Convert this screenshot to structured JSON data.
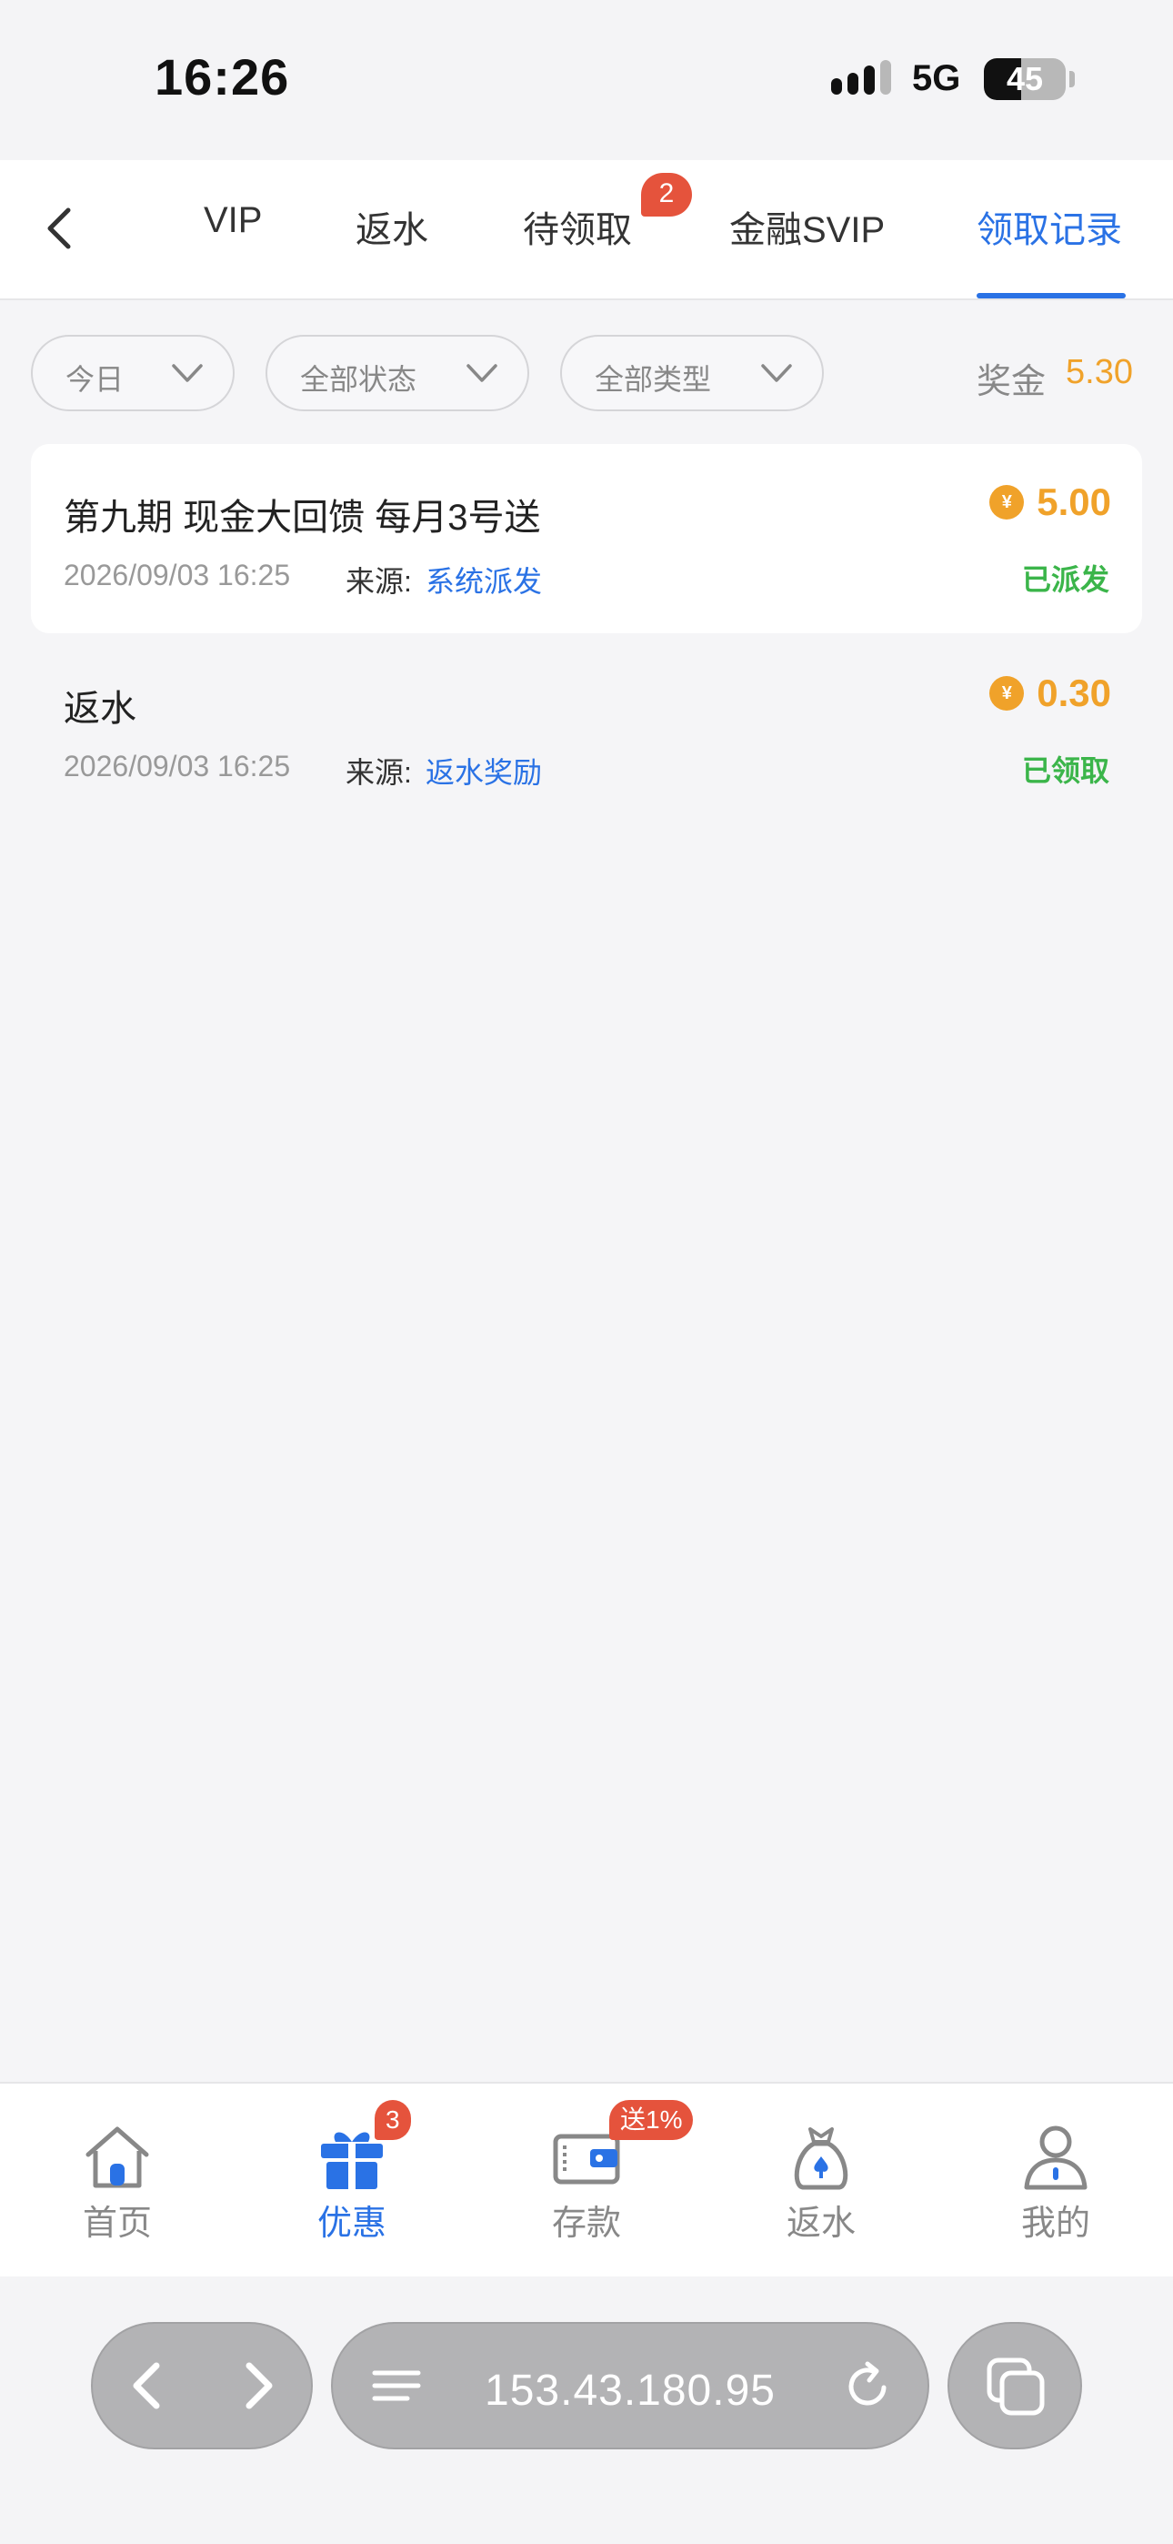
{
  "status_bar": {
    "time": "16:26",
    "network": "5G",
    "battery": "45",
    "battery_level": 0.45
  },
  "tabs": {
    "items": [
      {
        "label": "VIP"
      },
      {
        "label": "返水"
      },
      {
        "label": "待领取",
        "badge": "2"
      },
      {
        "label": "金融SVIP"
      },
      {
        "label": "领取记录",
        "active": true
      }
    ]
  },
  "filters": {
    "date": "今日",
    "status": "全部状态",
    "type": "全部类型",
    "bonus_label": "奖金",
    "bonus_value": "5.30"
  },
  "records": [
    {
      "title": "第九期 现金大回馈 每月3号送",
      "time": "2026/09/03 16:25",
      "source_label": "来源:",
      "source": "系统派发",
      "amount": "5.00",
      "status": "已派发"
    },
    {
      "title": "返水",
      "time": "2026/09/03 16:25",
      "source_label": "来源:",
      "source": "返水奖励",
      "amount": "0.30",
      "status": "已领取"
    }
  ],
  "coin_symbol": "¥",
  "bottom_nav": {
    "items": [
      {
        "label": "首页",
        "icon": "home-icon"
      },
      {
        "label": "优惠",
        "icon": "gift-icon",
        "badge": "3",
        "active": true
      },
      {
        "label": "存款",
        "icon": "wallet-icon",
        "badge": "送1%"
      },
      {
        "label": "返水",
        "icon": "money-bag-icon"
      },
      {
        "label": "我的",
        "icon": "user-icon"
      }
    ]
  },
  "browser": {
    "url": "153.43.180.95"
  },
  "colors": {
    "accent": "#2a72e5",
    "amount": "#f0a22a",
    "success": "#3bb54a",
    "badge": "#e5533c"
  }
}
